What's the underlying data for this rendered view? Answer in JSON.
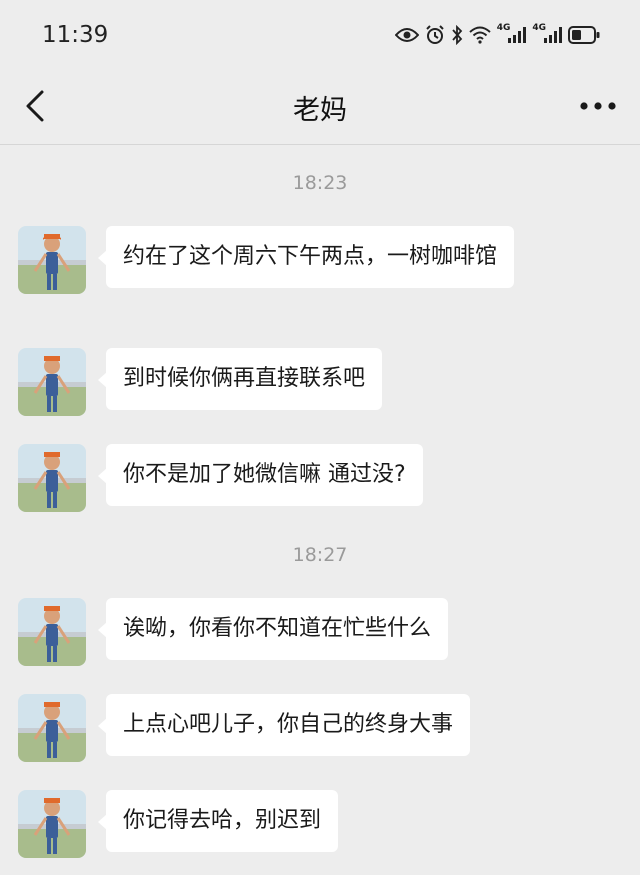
{
  "status_bar": {
    "time": "11:39",
    "net_label_1": "4G",
    "net_label_2": "4G"
  },
  "header": {
    "title": "老妈"
  },
  "chat": {
    "timestamps": [
      "18:23",
      "18:27"
    ],
    "messages": [
      "约在了这个周六下午两点，一树咖啡馆",
      "到时候你俩再直接联系吧",
      "你不是加了她微信嘛 通过没?",
      "诶呦，你看你不知道在忙些什么",
      "上点心吧儿子，你自己的终身大事",
      "你记得去哈，别迟到"
    ]
  }
}
